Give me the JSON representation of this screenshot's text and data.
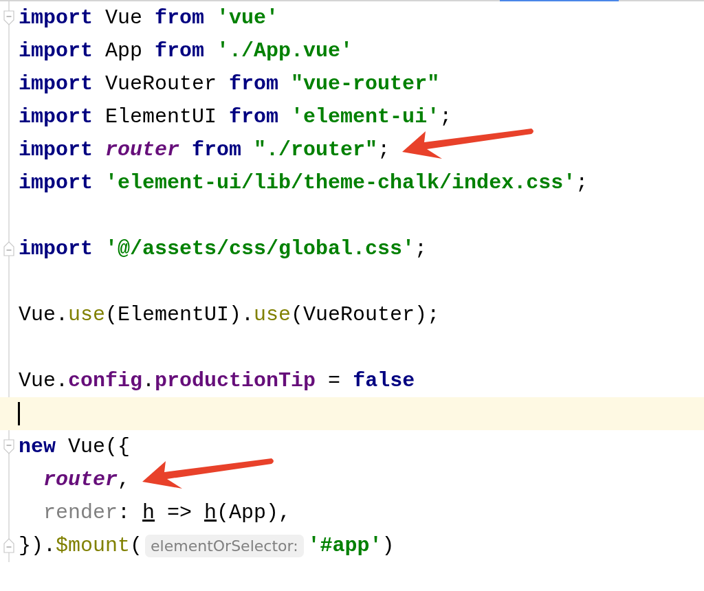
{
  "editor": {
    "lines": [
      {
        "kind": "code",
        "fold_start": true,
        "tokens": [
          {
            "kind": "keyword",
            "text": "import"
          },
          {
            "kind": "plain",
            "text": " Vue "
          },
          {
            "kind": "keyword",
            "text": "from"
          },
          {
            "kind": "string",
            "text": " 'vue'"
          }
        ]
      },
      {
        "kind": "code",
        "tokens": [
          {
            "kind": "keyword",
            "text": "import"
          },
          {
            "kind": "plain",
            "text": " App "
          },
          {
            "kind": "keyword",
            "text": "from"
          },
          {
            "kind": "string",
            "text": " './App.vue'"
          }
        ]
      },
      {
        "kind": "code",
        "tokens": [
          {
            "kind": "keyword",
            "text": "import"
          },
          {
            "kind": "plain",
            "text": " VueRouter "
          },
          {
            "kind": "keyword",
            "text": "from"
          },
          {
            "kind": "string",
            "text": " \"vue-router\""
          }
        ]
      },
      {
        "kind": "code",
        "tokens": [
          {
            "kind": "keyword",
            "text": "import"
          },
          {
            "kind": "plain",
            "text": " ElementUI "
          },
          {
            "kind": "keyword",
            "text": "from"
          },
          {
            "kind": "string",
            "text": " 'element-ui'"
          },
          {
            "kind": "plain",
            "text": ";"
          }
        ]
      },
      {
        "kind": "code",
        "arrow": true,
        "tokens": [
          {
            "kind": "keyword",
            "text": "import"
          },
          {
            "kind": "ident",
            "text": " router "
          },
          {
            "kind": "keyword",
            "text": "from"
          },
          {
            "kind": "string",
            "text": " \"./router\""
          },
          {
            "kind": "plain",
            "text": ";"
          }
        ]
      },
      {
        "kind": "code",
        "tokens": [
          {
            "kind": "keyword",
            "text": "import"
          },
          {
            "kind": "string",
            "text": " 'element-ui/lib/theme-chalk/index.css'"
          },
          {
            "kind": "plain",
            "text": ";"
          }
        ]
      },
      {
        "kind": "blank"
      },
      {
        "kind": "code",
        "fold_end": true,
        "tokens": [
          {
            "kind": "keyword",
            "text": "import"
          },
          {
            "kind": "string",
            "text": " '@/assets/css/global.css'"
          },
          {
            "kind": "plain",
            "text": ";"
          }
        ]
      },
      {
        "kind": "blank"
      },
      {
        "kind": "code",
        "tokens": [
          {
            "kind": "plain",
            "text": "Vue."
          },
          {
            "kind": "method",
            "text": "use"
          },
          {
            "kind": "plain",
            "text": "(ElementUI)."
          },
          {
            "kind": "method",
            "text": "use"
          },
          {
            "kind": "plain",
            "text": "(VueRouter);"
          }
        ]
      },
      {
        "kind": "blank"
      },
      {
        "kind": "code",
        "tokens": [
          {
            "kind": "plain",
            "text": "Vue."
          },
          {
            "kind": "property",
            "text": "config"
          },
          {
            "kind": "plain",
            "text": "."
          },
          {
            "kind": "property",
            "text": "productionTip"
          },
          {
            "kind": "plain",
            "text": " = "
          },
          {
            "kind": "keyword",
            "text": "false"
          }
        ]
      },
      {
        "kind": "blank",
        "current": true
      },
      {
        "kind": "code",
        "fold_start": true,
        "tokens": [
          {
            "kind": "keyword",
            "text": "new"
          },
          {
            "kind": "plain",
            "text": " Vue({"
          }
        ],
        "children": [
          {
            "kind": "code",
            "arrow": true,
            "tokens": [
              {
                "kind": "ident",
                "text": "router"
              },
              {
                "kind": "plain",
                "text": ","
              }
            ]
          },
          {
            "kind": "code",
            "tokens": [
              {
                "kind": "param",
                "text": "render"
              },
              {
                "kind": "plain",
                "text": ": "
              },
              {
                "kind": "underlined",
                "text": "h"
              },
              {
                "kind": "plain",
                "text": " => "
              },
              {
                "kind": "underlined",
                "text": "h"
              },
              {
                "kind": "plain",
                "text": "(App),"
              }
            ]
          }
        ]
      },
      {
        "kind": "code",
        "fold_end": true,
        "tokens": [
          {
            "kind": "plain",
            "text": "})."
          },
          {
            "kind": "method",
            "text": "$mount"
          },
          {
            "kind": "plain",
            "text": "("
          },
          {
            "kind": "hint",
            "text": "elementOrSelector:"
          },
          {
            "kind": "string",
            "text": "'#app'"
          },
          {
            "kind": "plain",
            "text": ")"
          }
        ]
      }
    ]
  }
}
